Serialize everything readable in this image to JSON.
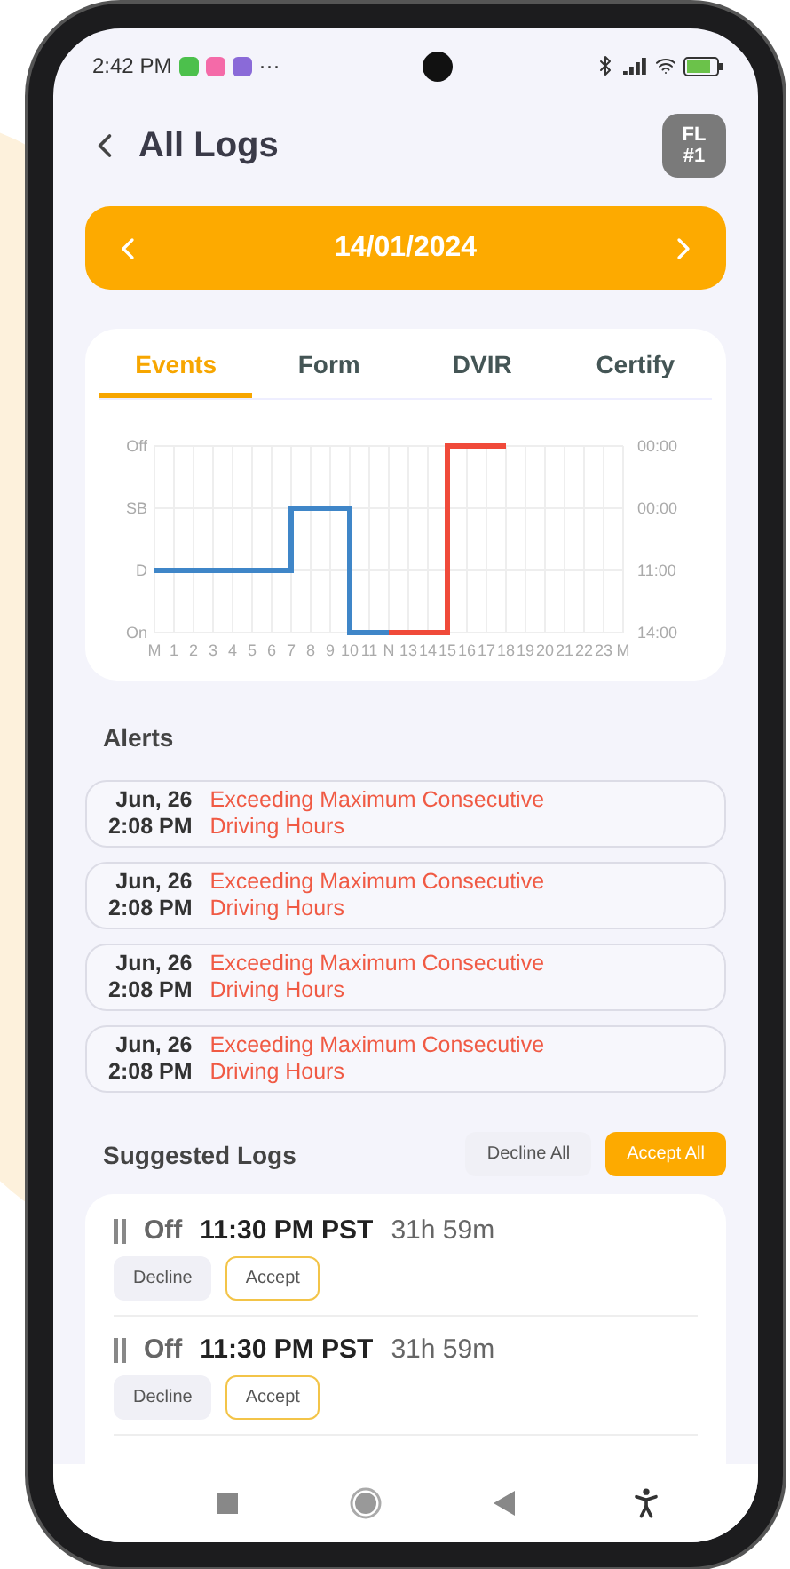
{
  "status_bar": {
    "time": "2:42 PM",
    "more": "···"
  },
  "header": {
    "title": "All Logs",
    "badge_line_1": "FL",
    "badge_line_2": "#1"
  },
  "date_bar": {
    "date": "14/01/2024"
  },
  "tabs": [
    {
      "label": "Events",
      "selected": true
    },
    {
      "label": "Form",
      "selected": false
    },
    {
      "label": "DVIR",
      "selected": false
    },
    {
      "label": "Certify",
      "selected": false
    }
  ],
  "graph": {
    "totals": [
      "00:00",
      "00:00",
      "11:00",
      "14:00"
    ],
    "y_labels": [
      "Off",
      "SB",
      "D",
      "On"
    ],
    "x_labels": [
      "M",
      "1",
      "2",
      "3",
      "4",
      "5",
      "6",
      "7",
      "8",
      "9",
      "10",
      "11",
      "N",
      "13",
      "14",
      "15",
      "16",
      "17",
      "18",
      "19",
      "20",
      "21",
      "22",
      "23",
      "M"
    ]
  },
  "alerts": {
    "title": "Alerts",
    "items": [
      {
        "date": "Jun, 26",
        "time": "2:08 PM",
        "message": "Exceeding Maximum Consecutive Driving Hours"
      },
      {
        "date": "Jun, 26",
        "time": "2:08 PM",
        "message": "Exceeding Maximum Consecutive Driving Hours"
      },
      {
        "date": "Jun, 26",
        "time": "2:08 PM",
        "message": "Exceeding Maximum Consecutive Driving Hours"
      },
      {
        "date": "Jun, 26",
        "time": "2:08 PM",
        "message": "Exceeding Maximum Consecutive Driving Hours"
      }
    ]
  },
  "suggested_logs": {
    "title": "Suggested Logs",
    "decline_all": "Decline All",
    "accept_all": "Accept All",
    "items": [
      {
        "status": "Off",
        "time": "11:30 PM PST",
        "duration": "31h 59m",
        "decline": "Decline",
        "accept": "Accept"
      },
      {
        "status": "Off",
        "time": "11:30 PM PST",
        "duration": "31h 59m",
        "decline": "Decline",
        "accept": "Accept"
      }
    ]
  }
}
